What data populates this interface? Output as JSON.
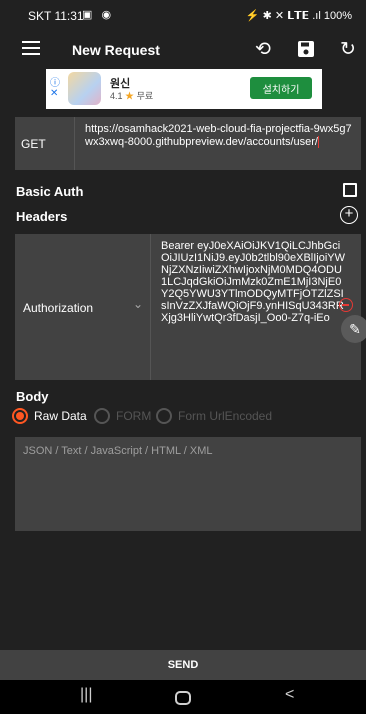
{
  "status_bar": {
    "time": "SKT 11:31",
    "right_text": "⚡ ✱ ✕ 𝗟𝗧𝗘 .ıl 100%"
  },
  "app_bar": {
    "title": "New Request",
    "icons": [
      "menu-icon",
      "history-icon",
      "save-icon",
      "refresh-icon"
    ]
  },
  "ad": {
    "app_name": "원신",
    "rating": "4.1",
    "star": "★",
    "price": "무료",
    "install_label": "설치하기",
    "info_icon": "ⓘ",
    "close_icon": "✕"
  },
  "request": {
    "method": "GET",
    "url": "https://osamhack2021-web-cloud-fia-projectfia-9wx5g7wx3xwq-8000.githubpreview.dev/accounts/user/"
  },
  "basic_auth": {
    "label": "Basic Auth",
    "checked": false
  },
  "headers": {
    "label": "Headers",
    "items": [
      {
        "key": "Authorization",
        "value": "Bearer eyJ0eXAiOiJKV1QiLCJhbGciOiJIUzI1NiJ9.eyJ0b2tlbl90eXBlIjoiYWNjZXNzIiwiZXhwIjoxNjM0MDQ4ODU1LCJqdGkiOiJmMzk0ZmE1MjI3NjE0Y2Q5YWU3YTlmODQyMTFjOTZlZSIsInVzZXJfaWQiOjF9.ynHISqU343RRXjg3HliYwtQr3fDasjI_Oo0-Z7q-iEo"
      }
    ]
  },
  "body": {
    "label": "Body",
    "options": [
      "Raw Data",
      "FORM",
      "Form UrlEncoded"
    ],
    "selected": "Raw Data",
    "placeholder": "JSON / Text / JavaScript / HTML / XML"
  },
  "send_label": "SEND",
  "nav": {
    "recent": "|||",
    "back": "<"
  },
  "colors": {
    "background": "#212121",
    "field": "#424242",
    "accent": "#ff5722",
    "danger": "#e53935",
    "ad_button": "#1e8e3e"
  }
}
